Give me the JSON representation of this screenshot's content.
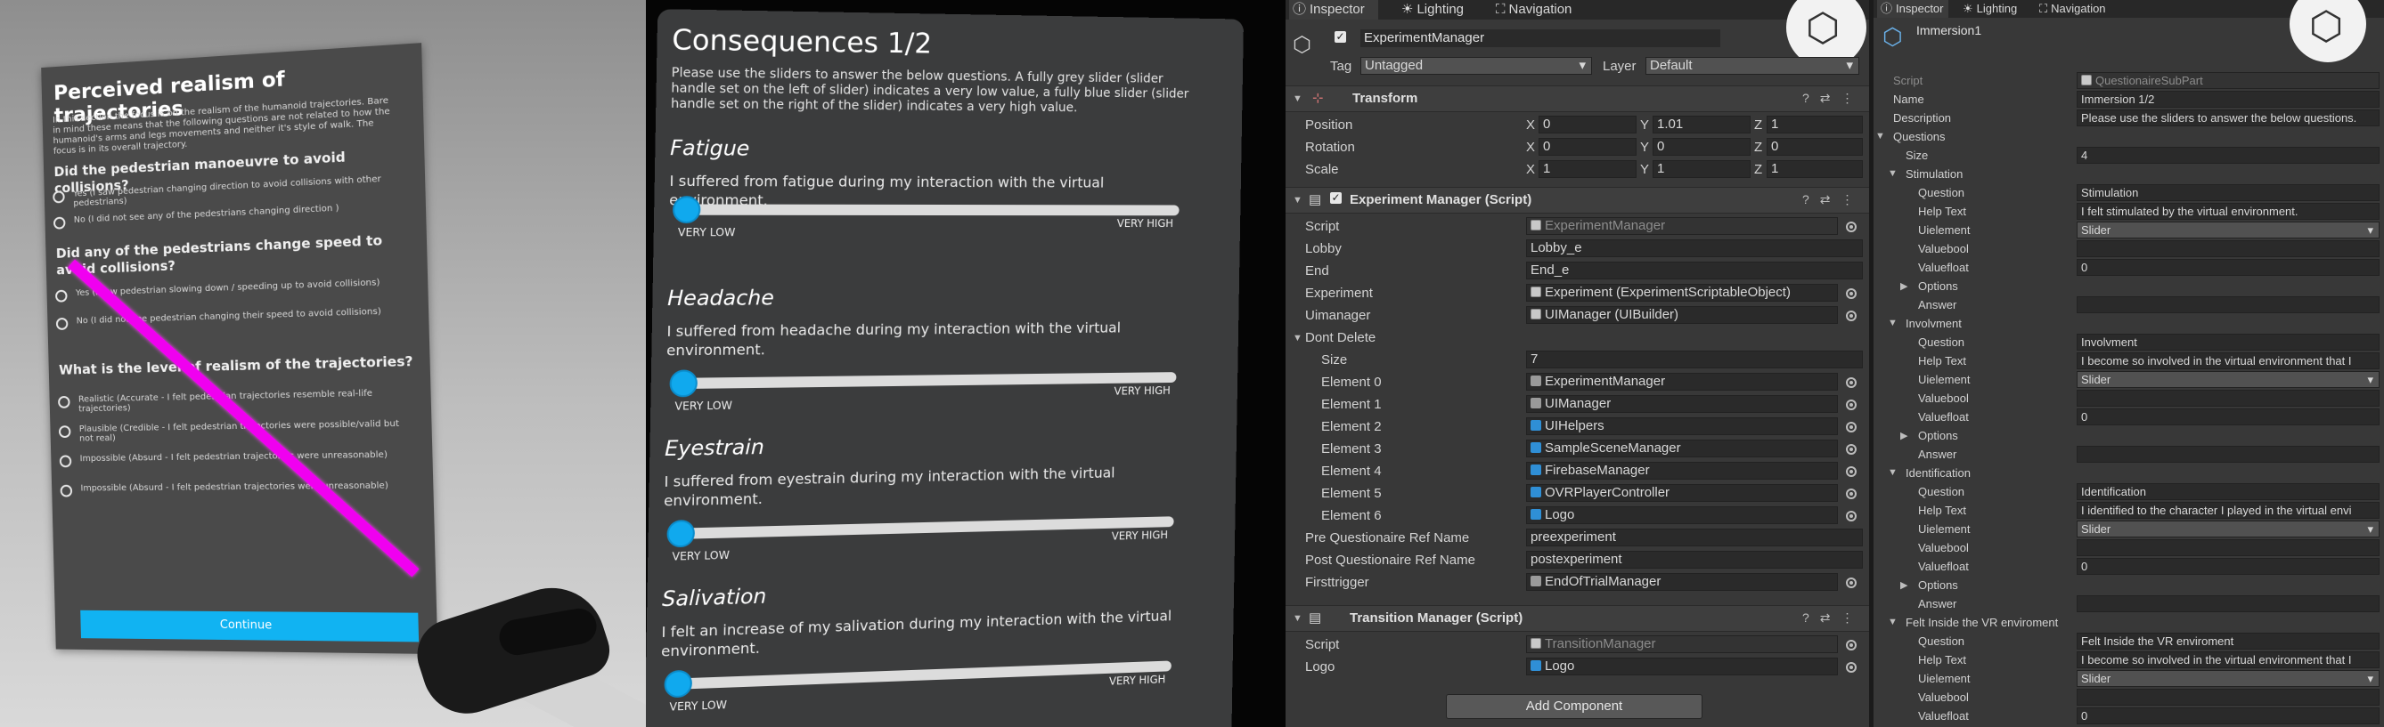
{
  "vr_trajectories": {
    "title": "Perceived realism of trajectories",
    "intro": "In this section the focus is on the realism of the humanoid trajectories. Bare in mind these means that the following questions are not related to how the humanoid's arms and legs movements and neither it's style of walk. The focus is in its overall trajectory.",
    "q1": "Did the pedestrian manoeuvre to avoid collisions?",
    "q1_options": [
      "Yes (I saw pedestrian changing direction to avoid collisions with other pedestrians)",
      "No (I did not see any of the pedestrians changing direction )"
    ],
    "q2": "Did any of the pedestrians change speed to avoid collisions?",
    "q2_options": [
      "Yes (I saw pedestrian slowing down / speeding up to avoid collisions)",
      "No (I did not see pedestrian changing their speed to avoid collisions)"
    ],
    "q3": "What is the level of realism of the trajectories?",
    "q3_options": [
      "Realistic (Accurate - I felt pedestrian trajectories resemble real-life trajectories)",
      "Plausible (Credible - I felt pedestrian trajectories were possible/valid but not real)",
      "Impossible (Absurd - I felt pedestrian trajectories were unreasonable)",
      "Impossible (Absurd - I felt pedestrian trajectories were unreasonable)"
    ],
    "continue_label": "Continue"
  },
  "vr_sliders": {
    "title": "Consequences 1/2",
    "intro": "Please use the sliders to answer the below questions. A fully grey slider (slider handle set on the left of slider) indicates a very low value, a fully blue slider (slider handle set on the right of the slider) indicates a very high value.",
    "low_label": "VERY LOW",
    "high_label": "VERY HIGH",
    "questions": [
      {
        "title": "Fatigue",
        "text": "I suffered from fatigue during my interaction with the virtual environment.",
        "value": 0
      },
      {
        "title": "Headache",
        "text": "I suffered from headache during my interaction with the virtual environment.",
        "value": 0
      },
      {
        "title": "Eyestrain",
        "text": "I suffered from eyestrain during my interaction with the virtual environment.",
        "value": 0
      },
      {
        "title": "Salivation",
        "text": "I felt an increase of my salivation during my interaction with the virtual environment.",
        "value": 0
      }
    ]
  },
  "inspector1": {
    "tabs": [
      "Inspector",
      "Lighting",
      "Navigation"
    ],
    "object_name": "ExperimentManager",
    "tag_label": "Tag",
    "tag_value": "Untagged",
    "layer_label": "Layer",
    "layer_value": "Default",
    "transform": {
      "title": "Transform",
      "position_label": "Position",
      "rotation_label": "Rotation",
      "scale_label": "Scale",
      "x": "X",
      "y": "Y",
      "z": "Z",
      "position": [
        "0",
        "1.01",
        "1"
      ],
      "rotation": [
        "0",
        "0",
        "0"
      ],
      "scale": [
        "1",
        "1",
        "1"
      ]
    },
    "experiment_manager": {
      "title": "Experiment Manager (Script)",
      "fields": [
        {
          "label": "Script",
          "value": "ExperimentManager",
          "disabled": true,
          "icon": "script-icon"
        },
        {
          "label": "Lobby",
          "value": "Lobby_e"
        },
        {
          "label": "End",
          "value": "End_e"
        },
        {
          "label": "Experiment",
          "value": "Experiment (ExperimentScriptableObject)",
          "icon": "scriptable-object-icon"
        },
        {
          "label": "Uimanager",
          "value": "UIManager (UIBuilder)",
          "icon": "script-icon"
        }
      ],
      "dont_delete_label": "Dont Delete",
      "size_label": "Size",
      "size_value": "7",
      "elements": [
        {
          "label": "Element 0",
          "value": "ExperimentManager",
          "icon": "gameobject-icon"
        },
        {
          "label": "Element 1",
          "value": "UIManager",
          "icon": "gameobject-icon"
        },
        {
          "label": "Element 2",
          "value": "UIHelpers",
          "icon": "prefab-icon"
        },
        {
          "label": "Element 3",
          "value": "SampleSceneManager",
          "icon": "prefab-icon"
        },
        {
          "label": "Element 4",
          "value": "FirebaseManager",
          "icon": "prefab-icon"
        },
        {
          "label": "Element 5",
          "value": "OVRPlayerController",
          "icon": "prefab-icon"
        },
        {
          "label": "Element 6",
          "value": "Logo",
          "icon": "prefab-icon"
        }
      ],
      "tail_fields": [
        {
          "label": "Pre Questionaire Ref Name",
          "value": "preexperiment"
        },
        {
          "label": "Post Questionaire Ref Name",
          "value": "postexperiment"
        },
        {
          "label": "Firsttrigger",
          "value": "EndOfTrialManager",
          "icon": "gameobject-icon"
        }
      ]
    },
    "transition_manager": {
      "title": "Transition Manager (Script)",
      "fields": [
        {
          "label": "Script",
          "value": "TransitionManager",
          "disabled": true,
          "icon": "script-icon"
        },
        {
          "label": "Logo",
          "value": "Logo",
          "icon": "prefab-icon"
        }
      ]
    },
    "add_component_label": "Add Component"
  },
  "inspector2": {
    "tabs": [
      "Inspector",
      "Lighting",
      "Navigation"
    ],
    "object_name": "Immersion1",
    "rows": [
      {
        "indent": 0,
        "label": "Script",
        "value": "QuestionaireSubPart",
        "disabled": true
      },
      {
        "indent": 0,
        "label": "Name",
        "value": "Immersion 1/2"
      },
      {
        "indent": 0,
        "label": "Description",
        "value": "Please use the sliders to answer the below questions."
      },
      {
        "indent": 0,
        "label": "Questions",
        "fold": "▼"
      },
      {
        "indent": 1,
        "label": "Size",
        "value": "4"
      },
      {
        "indent": 1,
        "label": "Stimulation",
        "fold": "▼"
      },
      {
        "indent": 2,
        "label": "Question",
        "value": "Stimulation"
      },
      {
        "indent": 2,
        "label": "Help Text",
        "value": "I felt stimulated by the virtual environment."
      },
      {
        "indent": 2,
        "label": "Uielement",
        "value": "Slider",
        "dropdown": true
      },
      {
        "indent": 2,
        "label": "Valuebool",
        "value": ""
      },
      {
        "indent": 2,
        "label": "Valuefloat",
        "value": "0"
      },
      {
        "indent": 2,
        "label": "Options",
        "fold": "▶"
      },
      {
        "indent": 2,
        "label": "Answer",
        "value": ""
      },
      {
        "indent": 1,
        "label": "Involvment",
        "fold": "▼"
      },
      {
        "indent": 2,
        "label": "Question",
        "value": "Involvment"
      },
      {
        "indent": 2,
        "label": "Help Text",
        "value": "I become so involved in the virtual environment that I"
      },
      {
        "indent": 2,
        "label": "Uielement",
        "value": "Slider",
        "dropdown": true
      },
      {
        "indent": 2,
        "label": "Valuebool",
        "value": ""
      },
      {
        "indent": 2,
        "label": "Valuefloat",
        "value": "0"
      },
      {
        "indent": 2,
        "label": "Options",
        "fold": "▶"
      },
      {
        "indent": 2,
        "label": "Answer",
        "value": ""
      },
      {
        "indent": 1,
        "label": "Identification",
        "fold": "▼"
      },
      {
        "indent": 2,
        "label": "Question",
        "value": "Identification"
      },
      {
        "indent": 2,
        "label": "Help Text",
        "value": "I identified to the character I played in the virtual envi"
      },
      {
        "indent": 2,
        "label": "Uielement",
        "value": "Slider",
        "dropdown": true
      },
      {
        "indent": 2,
        "label": "Valuebool",
        "value": ""
      },
      {
        "indent": 2,
        "label": "Valuefloat",
        "value": "0"
      },
      {
        "indent": 2,
        "label": "Options",
        "fold": "▶"
      },
      {
        "indent": 2,
        "label": "Answer",
        "value": ""
      },
      {
        "indent": 1,
        "label": "Felt Inside the VR enviroment",
        "fold": "▼"
      },
      {
        "indent": 2,
        "label": "Question",
        "value": "Felt Inside the VR enviroment"
      },
      {
        "indent": 2,
        "label": "Help Text",
        "value": "I become so involved in the virtual environment that I"
      },
      {
        "indent": 2,
        "label": "Uielement",
        "value": "Slider",
        "dropdown": true
      },
      {
        "indent": 2,
        "label": "Valuebool",
        "value": ""
      },
      {
        "indent": 2,
        "label": "Valuefloat",
        "value": "0"
      }
    ]
  },
  "colors": {
    "accent": "#11b3f2",
    "laser": "#f000f0",
    "unity_bg": "#383838",
    "slider_handle": "#10a9ee"
  }
}
